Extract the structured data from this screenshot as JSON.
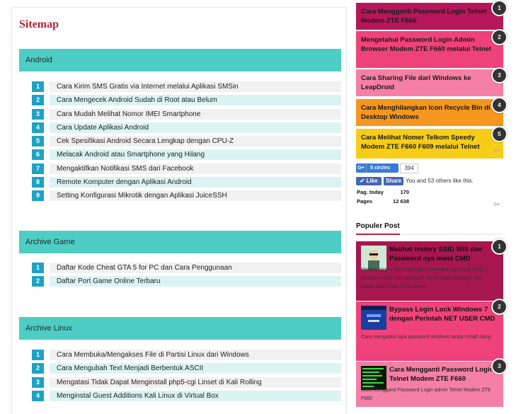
{
  "page_title": "Sitemap",
  "sections": [
    {
      "title": "Android",
      "items": [
        {
          "n": "1",
          "label": "Cara Kirim SMS Gratis via Internet melalui Aplikasi SMSin"
        },
        {
          "n": "2",
          "label": "Cara Mengecek Android Sudah di Root atau Belum"
        },
        {
          "n": "3",
          "label": "Cara Mudah Melihat Nomor IMEI Smartphone"
        },
        {
          "n": "4",
          "label": "Cara Update Aplikasi Android"
        },
        {
          "n": "5",
          "label": "Cek Spesifikasi Android Secara Lengkap dengan CPU-Z"
        },
        {
          "n": "6",
          "label": "Melacak Android atau Smartphone yang Hilang"
        },
        {
          "n": "7",
          "label": "Mengaktifkan Notifikasi SMS dari Facebook"
        },
        {
          "n": "8",
          "label": "Remote Komputer dengan Aplikasi Android"
        },
        {
          "n": "9",
          "label": "Setting Konfigurasi Mikrotik dengan Aplikasi JuiceSSH"
        }
      ]
    },
    {
      "title": "Archive Game",
      "items": [
        {
          "n": "1",
          "label": "Daftar Kode Cheat GTA 5 for PC dan Cara Penggunaan"
        },
        {
          "n": "2",
          "label": "Daftar Port Game Online Terbaru"
        }
      ]
    },
    {
      "title": "Archive Linux",
      "items": [
        {
          "n": "1",
          "label": "Cara Membuka/Mengakses File di Partisi Linux dari Windows"
        },
        {
          "n": "2",
          "label": "Cara Mengubah Text Menjadi Berbentuk ASCII"
        },
        {
          "n": "3",
          "label": "Mengatasi Tidak Dapat Menginstall php5-cgi Linset di Kali Rolling"
        },
        {
          "n": "4",
          "label": "Menginstal Guest Additions Kali Linux di Virtual Box"
        }
      ]
    }
  ],
  "sidebar": {
    "recent_posts": [
      {
        "n": "1",
        "title": "Cara Mengganti Password Login Telnet Modem ZTE F660",
        "color": "#b5175a"
      },
      {
        "n": "2",
        "title": "Mengetahui Password Login Admin Browser Modem ZTE F660 melalui Telnet",
        "color": "#f0427a"
      },
      {
        "n": "3",
        "title": "Cara Sharing File dari Windows ke LeapDroid",
        "color": "#f57fa6"
      },
      {
        "n": "4",
        "title": "Cara Menghilangkan Icon Recycle Bin di Desktop Windows",
        "color": "#f5961e"
      },
      {
        "n": "5",
        "title": "Cara Melihat Nomer Telkom Speedy Modem ZTE F660 F609 melalui Telnet",
        "color": "#f7cd18"
      }
    ],
    "social": {
      "gplus_label": "5 circles",
      "gplus_count": "394",
      "like_label": "Like",
      "share_label": "Share",
      "like_text": "You and 53 others like this."
    },
    "stats": {
      "today_label": "Pag. today",
      "today_value": "170",
      "pages_label": "Pages",
      "pages_value": "12 638"
    },
    "popular_title": "Populer Post",
    "popular_posts": [
      {
        "n": "1",
        "title": "Melihat history SSID Wifi dan Password nya lewat CMD",
        "desc": "Melihat history SSID Wifi dan Password nya lewat CMD. Mungkin kalian pernah log in wifi di suatu warung \\/ dan sudah lama tidak ke tempat it...",
        "color": "#a8164f"
      },
      {
        "n": "2",
        "title": "Bypass Login Lock Windows 7 dengan Perintah NET USER CMD",
        "desc": "Cara mengatasi lupa password windows tanpa install ulang",
        "color": "#f0427a"
      },
      {
        "n": "3",
        "title": "Cara Mengganti Password Login Telnet Modem ZTE F660",
        "desc": "Cara Mengganti Password Login admin Telnet Modem ZTE F660",
        "color": "#f57fa6"
      }
    ]
  }
}
